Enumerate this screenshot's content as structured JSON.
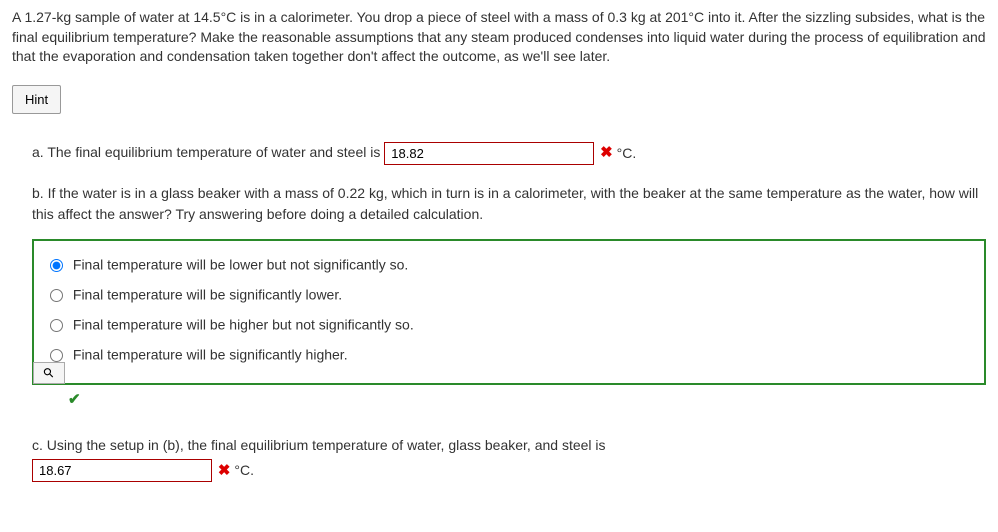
{
  "problem": "A 1.27-kg sample of water at 14.5°C is in a calorimeter. You drop a piece of steel with a mass of 0.3 kg at 201°C into it. After the sizzling subsides, what is the final equilibrium temperature? Make the reasonable assumptions that any steam produced condenses into liquid water during the process of equilibration and that the evaporation and condensation taken together don't affect the outcome, as we'll see later.",
  "hint_label": "Hint",
  "part_a": {
    "prompt": "a. The final equilibrium temperature of water and steel is",
    "value": "18.82",
    "unit": "°C."
  },
  "part_b": {
    "prompt": "b. If the water is in a glass beaker with a mass of 0.22 kg, which in turn is in a calorimeter, with the beaker at the same temperature as the water, how will this affect the answer? Try answering before doing a detailed calculation.",
    "options": [
      "Final temperature will be lower but not significantly so.",
      "Final temperature will be significantly lower.",
      "Final temperature will be higher but not significantly so.",
      "Final temperature will be significantly higher."
    ],
    "selected": 0
  },
  "part_c": {
    "prompt": "c. Using the setup in (b), the final equilibrium temperature of water, glass beaker, and steel is",
    "value": "18.67",
    "unit": "°C."
  },
  "icons": {
    "wrong": "✖",
    "correct": "✔",
    "toggle": "⚲"
  }
}
